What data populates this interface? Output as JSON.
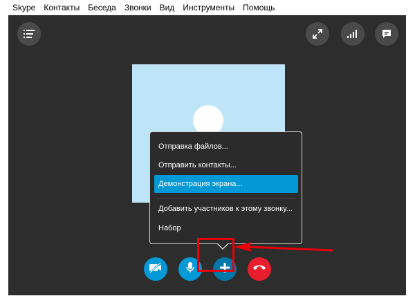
{
  "menubar": {
    "items": [
      {
        "label": "Skype"
      },
      {
        "label": "Контакты"
      },
      {
        "label": "Беседа"
      },
      {
        "label": "Звонки"
      },
      {
        "label": "Вид"
      },
      {
        "label": "Инструменты"
      },
      {
        "label": "Помощь"
      }
    ]
  },
  "top_controls": {
    "icons": [
      "list-menu-icon",
      "fullscreen-icon",
      "signal-quality-icon",
      "chat-icon"
    ]
  },
  "popup_menu": {
    "items": [
      {
        "label": "Отправка файлов..."
      },
      {
        "label": "Отправить контакты..."
      },
      {
        "label": "Демонстрация экрана..."
      },
      {
        "label": "Добавить участников к этому звонку..."
      },
      {
        "label": "Набор"
      }
    ],
    "selected_index": 2
  },
  "call_controls": {
    "icons": [
      "video-off-icon",
      "microphone-icon",
      "plus-icon",
      "hang-up-icon"
    ]
  },
  "colors": {
    "call_background": "#2d2d2d",
    "accent_blue": "#0299d6",
    "hangup_red": "#e81d2d",
    "annotation_red": "#e8000b",
    "avatar_tile": "#bde5f7"
  }
}
